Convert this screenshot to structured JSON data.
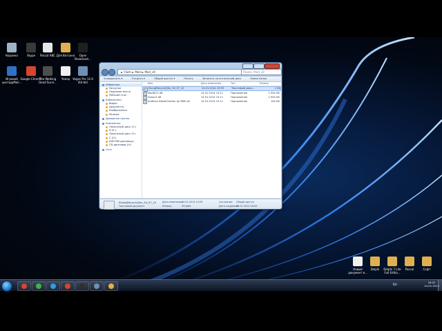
{
  "desktop_icons": [
    {
      "label": "Корзина",
      "color": "#9fb3c8"
    },
    {
      "label": "Skype",
      "color": "#3a3a3a"
    },
    {
      "label": "Pascal ABC",
      "color": "#e6e6e6"
    },
    {
      "label": "Для Ватсона",
      "color": "#e0b050"
    },
    {
      "label": "Open Broadcast...",
      "color": "#202020"
    },
    {
      "label": "Игровой центр@Mail...",
      "color": "#2f72c4"
    },
    {
      "label": "Google Chrome",
      "color": "#d6452f"
    },
    {
      "label": "The Walking Dead Survi...",
      "color": "#4d4d4d"
    },
    {
      "label": "Чекер",
      "color": "#f0f0f0"
    },
    {
      "label": "Vegas Pro 12.0 (64-bit)",
      "color": "#6f8fb5"
    }
  ],
  "right_icons": [
    {
      "label": "Новый документ в...",
      "color": "#f0f0f0"
    },
    {
      "label": "Delphi",
      "color": "#e0b050"
    },
    {
      "label": "Delphi 7 Lite Full Editio...",
      "color": "#e0b050"
    },
    {
      "label": "Pascal",
      "color": "#e0b050"
    },
    {
      "label": "Софт",
      "color": "#e0b050"
    }
  ],
  "window": {
    "address": "► Flash ► Mod ► Mod_v9",
    "search_placeholder": "Поиск: Mod_v9",
    "toolbar": [
      "Упорядочить ▾",
      "Открыть ▾",
      "Общий доступ ▾",
      "Печать",
      "Записать на оптический диск",
      "Новая папка"
    ],
    "sidebar": [
      {
        "label": "Избранное",
        "group": true,
        "sel": true
      },
      {
        "label": "Загрузки",
        "group": false
      },
      {
        "label": "Недавние места",
        "group": false
      },
      {
        "label": "Рабочий стол",
        "group": false
      },
      {
        "label": "Библиотеки",
        "group": true
      },
      {
        "label": "Видео",
        "group": false
      },
      {
        "label": "Документы",
        "group": false
      },
      {
        "label": "Изображения",
        "group": false
      },
      {
        "label": "Музыка",
        "group": false
      },
      {
        "label": "Домашняя группа",
        "group": true
      },
      {
        "label": "Компьютер",
        "group": true
      },
      {
        "label": "Локальный диск (C:)",
        "group": false
      },
      {
        "label": "D (E:)",
        "group": false
      },
      {
        "label": "Локальный диск (F:)",
        "group": false
      },
      {
        "label": "C (G:)",
        "group": false
      },
      {
        "label": "DVD RW дисковод (",
        "group": false
      },
      {
        "label": "CD-дисковод (H:)",
        "group": false
      },
      {
        "label": "Сеть",
        "group": true
      }
    ],
    "columns": [
      "Имя",
      "Дата изменения",
      "Тип",
      "Размер"
    ],
    "files": [
      {
        "name": "Elona[Recycle]Ver_34_07_12",
        "date": "14.01.2014 19:59",
        "type": "Текстовый доку...",
        "size": "1 КБ",
        "sel": true
      },
      {
        "name": "Mod@12.48",
        "date": "14.01.2014 13:11",
        "type": "Приложение",
        "size": "2 904 КБ",
        "sel": false
      },
      {
        "name": "mlap12.48",
        "date": "14.01.2014 13:11",
        "type": "Приложение",
        "size": "2 904 КБ",
        "sel": false
      },
      {
        "name": "Andhero BlazeChecker by MBS v8",
        "date": "14.01.2014 13:11",
        "type": "Приложение",
        "size": "144 КБ",
        "sel": false
      }
    ],
    "details": {
      "name": "Elona[Recycle]Ver_34_07_12",
      "type": "Текстовый документ",
      "modified_label": "Дата изменения:",
      "modified": "14.01.2014 19:59",
      "size_label": "Размер:",
      "size": "55 байт",
      "created_label": "Дата создания:",
      "created": "08.01.2014 16:09",
      "state_label": "Состояние:",
      "state": "Общий доступ"
    }
  },
  "taskbar": {
    "lang": "RU",
    "time": "18:22",
    "date": "14.01.2014",
    "items": [
      {
        "name": "taskbar-chrome",
        "color": "#d6452f"
      },
      {
        "name": "taskbar-green",
        "color": "#3fb04a"
      },
      {
        "name": "taskbar-skype",
        "color": "#2a9fe0"
      },
      {
        "name": "taskbar-chrome-2",
        "color": "#d6452f"
      },
      {
        "name": "taskbar-obs",
        "color": "#303030"
      },
      {
        "name": "taskbar-vegas",
        "color": "#6f8fb5"
      },
      {
        "name": "taskbar-explorer",
        "color": "#e0b050"
      }
    ]
  }
}
